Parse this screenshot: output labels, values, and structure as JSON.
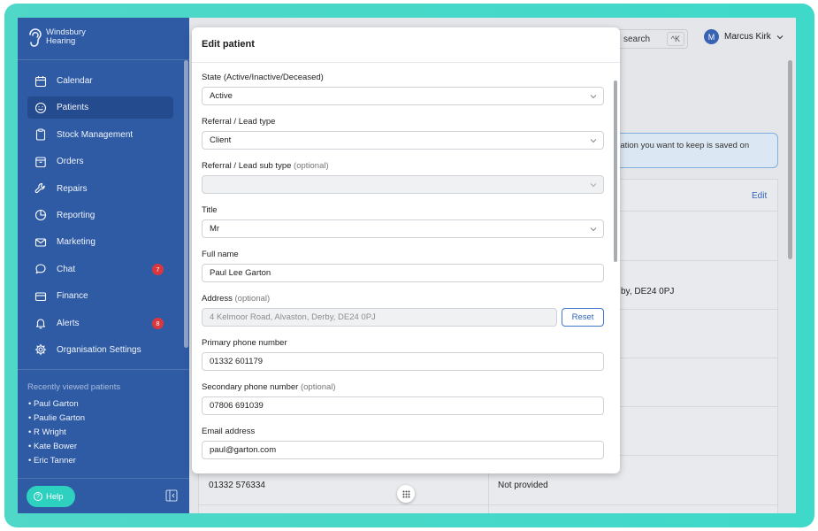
{
  "brand": {
    "line1": "Windsbury",
    "line2": "Hearing"
  },
  "nav": [
    {
      "label": "Calendar",
      "icon": "calendar-icon"
    },
    {
      "label": "Patients",
      "icon": "smile-icon",
      "active": true
    },
    {
      "label": "Stock Management",
      "icon": "clipboard-icon"
    },
    {
      "label": "Orders",
      "icon": "box-icon"
    },
    {
      "label": "Repairs",
      "icon": "wrench-icon"
    },
    {
      "label": "Reporting",
      "icon": "pie-chart-icon"
    },
    {
      "label": "Marketing",
      "icon": "mail-icon"
    },
    {
      "label": "Chat",
      "icon": "chat-icon",
      "badge": "7"
    },
    {
      "label": "Finance",
      "icon": "card-icon"
    },
    {
      "label": "Alerts",
      "icon": "bell-icon",
      "badge": "8"
    },
    {
      "label": "Organisation Settings",
      "icon": "gear-icon"
    }
  ],
  "recent": {
    "title": "Recently viewed patients",
    "items": [
      "• Paul Garton",
      "• Paulie Garton",
      "• R Wright",
      "• Kate Bower",
      "• Eric Tanner"
    ]
  },
  "help_label": "Help",
  "topbar": {
    "search_label": "search",
    "shortcut": "^K",
    "user_initial": "M",
    "user_name": "Marcus Kirk"
  },
  "background": {
    "banner_line1": "ormation you want to keep is saved on",
    "edit_label": "Edit",
    "address_fragment": "by, DE24 0PJ",
    "phone": "01332 576334",
    "not_provided": "Not provided"
  },
  "modal": {
    "title": "Edit patient",
    "fields": {
      "state": {
        "label": "State (Active/Inactive/Deceased)",
        "value": "Active"
      },
      "referral": {
        "label": "Referral / Lead type",
        "value": "Client"
      },
      "referral_sub": {
        "label": "Referral / Lead sub type",
        "optional": "(optional)",
        "value": ""
      },
      "title": {
        "label": "Title",
        "value": "Mr"
      },
      "full_name": {
        "label": "Full name",
        "value": "Paul Lee Garton"
      },
      "address": {
        "label": "Address",
        "optional": "(optional)",
        "placeholder": "4 Kelmoor Road, Alvaston, Derby, DE24 0PJ",
        "reset_label": "Reset"
      },
      "primary_phone": {
        "label": "Primary phone number",
        "value": "01332 601179"
      },
      "secondary_phone": {
        "label": "Secondary phone number",
        "optional": "(optional)",
        "value": "07806 691039"
      },
      "email": {
        "label": "Email address",
        "value": "paul@garton.com"
      }
    }
  },
  "colors": {
    "sidebar": "#2f5ba5",
    "accent": "#2ed1c0",
    "frame": "#4fd7c8",
    "badge": "#d9373b"
  }
}
